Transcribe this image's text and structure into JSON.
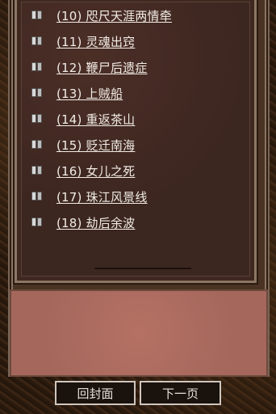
{
  "chapters": [
    "(10) 咫尺天涯两情牵",
    "(11) 灵魂出窍",
    "(12) 鞭尸后遗症",
    "(13) 上贼船",
    "(14) 重返茶山",
    "(15) 贬迁南海",
    "(16) 女儿之死",
    "(17) 珠江风景线",
    "(18) 劫后余波"
  ],
  "nav": {
    "back_to_cover": "回封面",
    "next_page": "下一页"
  },
  "icons": {
    "chapter_item": "book-icon"
  }
}
